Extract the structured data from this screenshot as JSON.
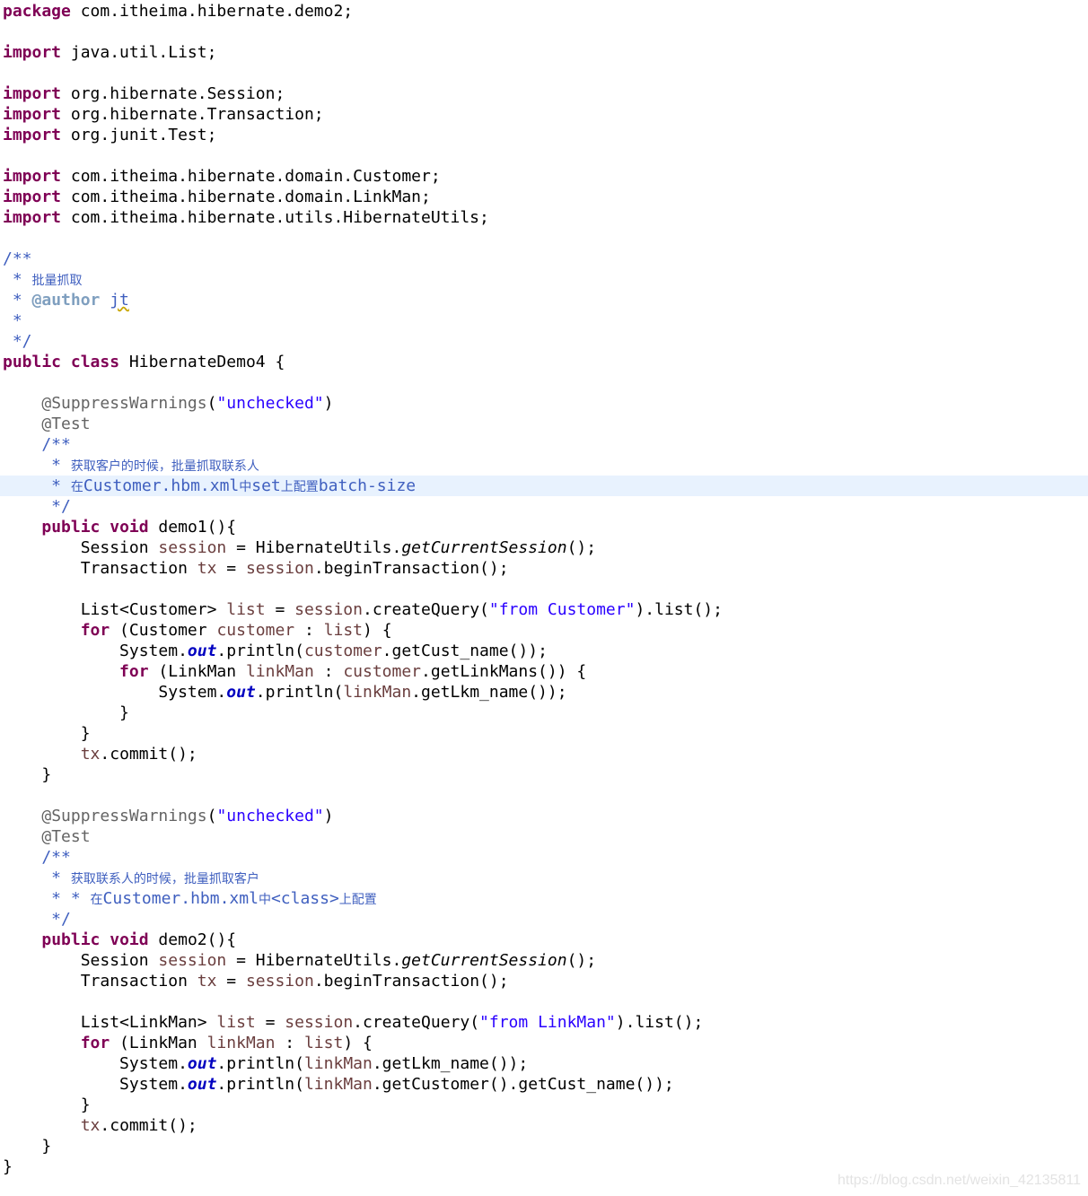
{
  "editor": {
    "lines": [
      [
        {
          "t": "package",
          "c": "k"
        },
        {
          "t": " com.itheima.hibernate.demo2;"
        }
      ],
      [],
      [
        {
          "t": "import",
          "c": "k"
        },
        {
          "t": " java.util.List;"
        }
      ],
      [],
      [
        {
          "t": "import",
          "c": "k"
        },
        {
          "t": " org.hibernate.Session;"
        }
      ],
      [
        {
          "t": "import",
          "c": "k"
        },
        {
          "t": " org.hibernate.Transaction;"
        }
      ],
      [
        {
          "t": "import",
          "c": "k"
        },
        {
          "t": " org.junit.Test;"
        }
      ],
      [],
      [
        {
          "t": "import",
          "c": "k"
        },
        {
          "t": " com.itheima.hibernate.domain.Customer;"
        }
      ],
      [
        {
          "t": "import",
          "c": "k"
        },
        {
          "t": " com.itheima.hibernate.domain.LinkMan;"
        }
      ],
      [
        {
          "t": "import",
          "c": "k"
        },
        {
          "t": " com.itheima.hibernate.utils.HibernateUtils;"
        }
      ],
      [],
      [
        {
          "t": "/**",
          "c": "c"
        }
      ],
      [
        {
          "t": " * ",
          "c": "c"
        },
        {
          "t": "批量抓取",
          "c": "c cjk"
        }
      ],
      [
        {
          "t": " * ",
          "c": "c"
        },
        {
          "t": "@author",
          "c": "ct"
        },
        {
          "t": " ",
          "c": "c"
        },
        {
          "t": "jt",
          "c": "c sp"
        }
      ],
      [
        {
          "t": " *",
          "c": "c"
        }
      ],
      [
        {
          "t": " */",
          "c": "c"
        }
      ],
      [
        {
          "t": "public",
          "c": "k"
        },
        {
          "t": " "
        },
        {
          "t": "class",
          "c": "k"
        },
        {
          "t": " HibernateDemo4 {"
        }
      ],
      [],
      [
        {
          "t": "    "
        },
        {
          "t": "@SuppressWarnings",
          "c": "an"
        },
        {
          "t": "("
        },
        {
          "t": "\"unchecked\"",
          "c": "s"
        },
        {
          "t": ")"
        }
      ],
      [
        {
          "t": "    "
        },
        {
          "t": "@Test",
          "c": "an"
        }
      ],
      [
        {
          "t": "    /**",
          "c": "c"
        }
      ],
      [
        {
          "t": "     * ",
          "c": "c"
        },
        {
          "t": "获取客户的时候，批量抓取联系人",
          "c": "c cjk"
        }
      ],
      [
        {
          "t": "     * ",
          "c": "c"
        },
        {
          "t": "在",
          "c": "c cjk"
        },
        {
          "t": "Customer.hbm.xml",
          "c": "c"
        },
        {
          "t": "中",
          "c": "c cjk"
        },
        {
          "t": "set",
          "c": "c"
        },
        {
          "t": "上配置",
          "c": "c cjk"
        },
        {
          "t": "batch-size",
          "c": "c"
        }
      ],
      [
        {
          "t": "     */",
          "c": "c"
        }
      ],
      [
        {
          "t": "    "
        },
        {
          "t": "public",
          "c": "k"
        },
        {
          "t": " "
        },
        {
          "t": "void",
          "c": "k"
        },
        {
          "t": " demo1(){"
        }
      ],
      [
        {
          "t": "        Session "
        },
        {
          "t": "session",
          "c": "v"
        },
        {
          "t": " = HibernateUtils."
        },
        {
          "t": "getCurrentSession",
          "c": "i"
        },
        {
          "t": "();"
        }
      ],
      [
        {
          "t": "        Transaction "
        },
        {
          "t": "tx",
          "c": "v"
        },
        {
          "t": " = "
        },
        {
          "t": "session",
          "c": "v"
        },
        {
          "t": ".beginTransaction();"
        }
      ],
      [],
      [
        {
          "t": "        List<Customer> "
        },
        {
          "t": "list",
          "c": "v"
        },
        {
          "t": " = "
        },
        {
          "t": "session",
          "c": "v"
        },
        {
          "t": ".createQuery("
        },
        {
          "t": "\"from Customer\"",
          "c": "s"
        },
        {
          "t": ").list();"
        }
      ],
      [
        {
          "t": "        "
        },
        {
          "t": "for",
          "c": "k"
        },
        {
          "t": " (Customer "
        },
        {
          "t": "customer",
          "c": "v"
        },
        {
          "t": " : "
        },
        {
          "t": "list",
          "c": "v"
        },
        {
          "t": ") {"
        }
      ],
      [
        {
          "t": "            System."
        },
        {
          "t": "out",
          "c": "f"
        },
        {
          "t": ".println("
        },
        {
          "t": "customer",
          "c": "v"
        },
        {
          "t": ".getCust_name());"
        }
      ],
      [
        {
          "t": "            "
        },
        {
          "t": "for",
          "c": "k"
        },
        {
          "t": " (LinkMan "
        },
        {
          "t": "linkMan",
          "c": "v"
        },
        {
          "t": " : "
        },
        {
          "t": "customer",
          "c": "v"
        },
        {
          "t": ".getLinkMans()) {"
        }
      ],
      [
        {
          "t": "                System."
        },
        {
          "t": "out",
          "c": "f"
        },
        {
          "t": ".println("
        },
        {
          "t": "linkMan",
          "c": "v"
        },
        {
          "t": ".getLkm_name());"
        }
      ],
      [
        {
          "t": "            }"
        }
      ],
      [
        {
          "t": "        }"
        }
      ],
      [
        {
          "t": "        "
        },
        {
          "t": "tx",
          "c": "v"
        },
        {
          "t": ".commit();"
        }
      ],
      [
        {
          "t": "    }"
        }
      ],
      [],
      [
        {
          "t": "    "
        },
        {
          "t": "@SuppressWarnings",
          "c": "an"
        },
        {
          "t": "("
        },
        {
          "t": "\"unchecked\"",
          "c": "s"
        },
        {
          "t": ")"
        }
      ],
      [
        {
          "t": "    "
        },
        {
          "t": "@Test",
          "c": "an"
        }
      ],
      [
        {
          "t": "    /**",
          "c": "c"
        }
      ],
      [
        {
          "t": "     * ",
          "c": "c"
        },
        {
          "t": "获取联系人的时候，批量抓取客户",
          "c": "c cjk"
        }
      ],
      [
        {
          "t": "     * * ",
          "c": "c"
        },
        {
          "t": "在",
          "c": "c cjk"
        },
        {
          "t": "Customer.hbm.xml",
          "c": "c"
        },
        {
          "t": "中",
          "c": "c cjk"
        },
        {
          "t": "<class>",
          "c": "cn"
        },
        {
          "t": "上配置",
          "c": "c cjk"
        }
      ],
      [
        {
          "t": "     */",
          "c": "c"
        }
      ],
      [
        {
          "t": "    "
        },
        {
          "t": "public",
          "c": "k"
        },
        {
          "t": " "
        },
        {
          "t": "void",
          "c": "k"
        },
        {
          "t": " demo2(){"
        }
      ],
      [
        {
          "t": "        Session "
        },
        {
          "t": "session",
          "c": "v"
        },
        {
          "t": " = HibernateUtils."
        },
        {
          "t": "getCurrentSession",
          "c": "i"
        },
        {
          "t": "();"
        }
      ],
      [
        {
          "t": "        Transaction "
        },
        {
          "t": "tx",
          "c": "v"
        },
        {
          "t": " = "
        },
        {
          "t": "session",
          "c": "v"
        },
        {
          "t": ".beginTransaction();"
        }
      ],
      [],
      [
        {
          "t": "        List<LinkMan> "
        },
        {
          "t": "list",
          "c": "v"
        },
        {
          "t": " = "
        },
        {
          "t": "session",
          "c": "v"
        },
        {
          "t": ".createQuery("
        },
        {
          "t": "\"from LinkMan\"",
          "c": "s"
        },
        {
          "t": ").list();"
        }
      ],
      [
        {
          "t": "        "
        },
        {
          "t": "for",
          "c": "k"
        },
        {
          "t": " (LinkMan "
        },
        {
          "t": "linkMan",
          "c": "v"
        },
        {
          "t": " : "
        },
        {
          "t": "list",
          "c": "v"
        },
        {
          "t": ") {"
        }
      ],
      [
        {
          "t": "            System."
        },
        {
          "t": "out",
          "c": "f"
        },
        {
          "t": ".println("
        },
        {
          "t": "linkMan",
          "c": "v"
        },
        {
          "t": ".getLkm_name());"
        }
      ],
      [
        {
          "t": "            System."
        },
        {
          "t": "out",
          "c": "f"
        },
        {
          "t": ".println("
        },
        {
          "t": "linkMan",
          "c": "v"
        },
        {
          "t": ".getCustomer().getCust_name());"
        }
      ],
      [
        {
          "t": "        }"
        }
      ],
      [
        {
          "t": "        "
        },
        {
          "t": "tx",
          "c": "v"
        },
        {
          "t": ".commit();"
        }
      ],
      [
        {
          "t": "    }"
        }
      ],
      [
        {
          "t": "}"
        }
      ]
    ],
    "current_line": 24
  },
  "watermark": "https://blog.csdn.net/weixin_42135811"
}
